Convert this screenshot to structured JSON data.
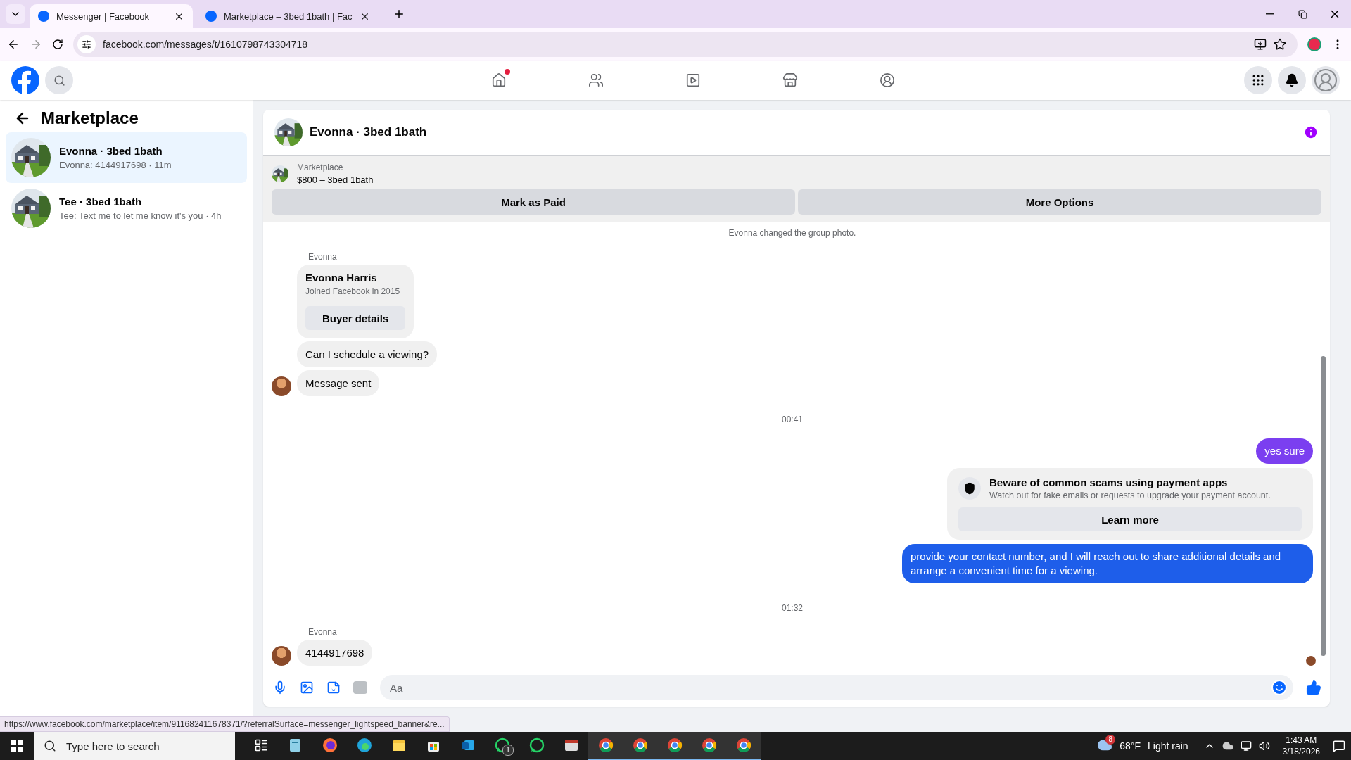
{
  "browser": {
    "tabs": [
      {
        "title": "Messenger | Facebook",
        "selected": true
      },
      {
        "title": "Marketplace – 3bed 1bath | Fac",
        "selected": false
      }
    ],
    "url": "facebook.com/messages/t/1610798743304718"
  },
  "nav": [
    {
      "kind": "home",
      "dot": true
    },
    {
      "kind": "friends",
      "dot": false
    },
    {
      "kind": "video",
      "dot": false
    },
    {
      "kind": "marketplace",
      "dot": false
    },
    {
      "kind": "groups",
      "dot": false
    }
  ],
  "sidebar": {
    "title": "Marketplace",
    "conversations": [
      {
        "name": "Evonna · 3bed 1bath",
        "preview": "Evonna: 4144917698 · 11m",
        "selected": true
      },
      {
        "name": "Tee · 3bed 1bath",
        "preview": "Tee: Text me to let me know it's you · 4h",
        "selected": false
      }
    ]
  },
  "chat": {
    "title": "Evonna · 3bed 1bath",
    "listing": {
      "label": "Marketplace",
      "title": "$800 – 3bed 1bath",
      "buttons": [
        "Mark as Paid",
        "More Options"
      ]
    },
    "messages": [
      {
        "kind": "system",
        "text": "Evonna changed the group photo."
      },
      {
        "kind": "sender",
        "text": "Evonna"
      },
      {
        "kind": "profile",
        "name": "Evonna Harris",
        "detail": "Joined Facebook in 2015",
        "button": "Buyer details"
      },
      {
        "kind": "incoming",
        "text": "Can I schedule a viewing?",
        "avatar": false
      },
      {
        "kind": "incoming",
        "text": "Message sent",
        "avatar": true
      },
      {
        "kind": "time",
        "text": "00:41"
      },
      {
        "kind": "outgoing",
        "text": "yes sure",
        "color": "#7b3ff0"
      },
      {
        "kind": "notice",
        "title": "Beware of common scams using payment apps",
        "text": "Watch out for fake emails or requests to upgrade your payment account.",
        "button": "Learn more"
      },
      {
        "kind": "outgoing",
        "text": "provide your contact number, and I will reach out to share additional details and arrange a convenient time for a viewing.",
        "color": "#1e5eea"
      },
      {
        "kind": "time",
        "text": "01:32"
      },
      {
        "kind": "sender",
        "text": "Evonna"
      },
      {
        "kind": "incoming",
        "text": "4144917698",
        "avatar": true
      }
    ],
    "input": {
      "placeholder": "Aa"
    }
  },
  "status_url": "https://www.facebook.com/marketplace/item/911682411678371/?referralSurface=messenger_lightspeed_banner&re...",
  "taskbar": {
    "search_placeholder": "Type here to search",
    "apps": [
      {
        "kind": "taskview",
        "open": false
      },
      {
        "kind": "notepad",
        "open": false
      },
      {
        "kind": "firefox",
        "open": false
      },
      {
        "kind": "edge",
        "open": false
      },
      {
        "kind": "explorer",
        "open": false
      },
      {
        "kind": "store",
        "open": false
      },
      {
        "kind": "outlook",
        "open": false
      },
      {
        "kind": "whatsapp",
        "open": false,
        "badge": "1"
      },
      {
        "kind": "whatsapp",
        "open": false
      },
      {
        "kind": "window",
        "open": false
      },
      {
        "kind": "chrome",
        "open": true
      },
      {
        "kind": "chrome",
        "open": true
      },
      {
        "kind": "chrome",
        "open": true
      },
      {
        "kind": "chrome",
        "open": true
      },
      {
        "kind": "chrome",
        "open": true
      }
    ],
    "weather_badge": "8",
    "temperature": "68°F",
    "weather": "Light rain",
    "time": "1:43 AM",
    "date": "3/18/2026"
  }
}
